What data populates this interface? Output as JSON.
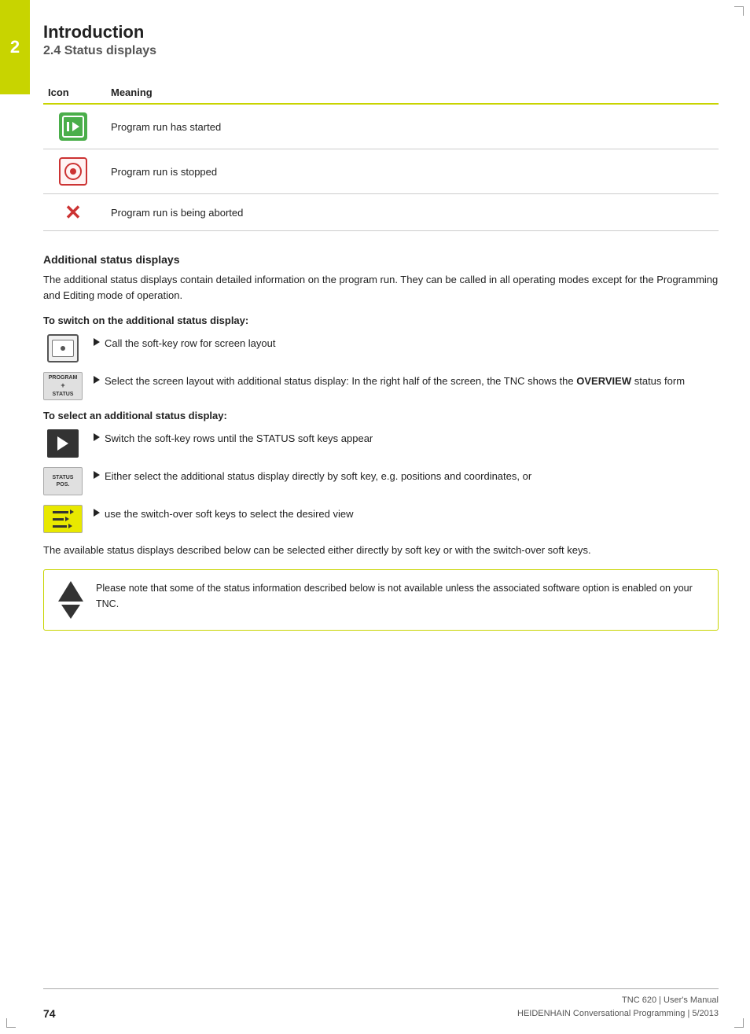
{
  "chapter": {
    "number": "2",
    "title": "Introduction",
    "section": "2.4    Status displays"
  },
  "table": {
    "col_icon": "Icon",
    "col_meaning": "Meaning",
    "rows": [
      {
        "icon_type": "play",
        "meaning": "Program run has started"
      },
      {
        "icon_type": "stop",
        "meaning": "Program run is stopped"
      },
      {
        "icon_type": "abort",
        "meaning": "Program run is being aborted"
      }
    ]
  },
  "additional": {
    "title": "Additional status displays",
    "body": "The additional status displays contain detailed information on the program run. They can be called in all operating modes except for the Programming and Editing mode of operation.",
    "switch_on": {
      "label": "To switch on the additional status display:",
      "steps": [
        {
          "icon": "screen",
          "text": "Call the soft-key row for screen layout"
        },
        {
          "icon": "program-status",
          "text": "Select the screen layout with additional status display: In the right half of the screen, the TNC shows the OVERVIEW status form",
          "bold_word": "OVERVIEW"
        }
      ]
    },
    "select": {
      "label": "To select an additional status display:",
      "steps": [
        {
          "icon": "arrow-right",
          "text": "Switch the soft-key rows until the STATUS soft keys appear"
        },
        {
          "icon": "status-pos",
          "text": "Either select the additional status display directly by soft key, e.g. positions and coordinates, or"
        },
        {
          "icon": "switchover",
          "text": "use the switch-over soft keys to select the desired view"
        }
      ]
    },
    "body2": "The available status displays described below can be selected either directly by soft key or with the switch-over soft keys.",
    "note": "Please note that some of the status information described below is not available unless the associated software option is enabled on your TNC."
  },
  "footer": {
    "page": "74",
    "product_line1": "TNC 620 | User's Manual",
    "product_line2": "HEIDENHAIN Conversational Programming | 5/2013"
  }
}
